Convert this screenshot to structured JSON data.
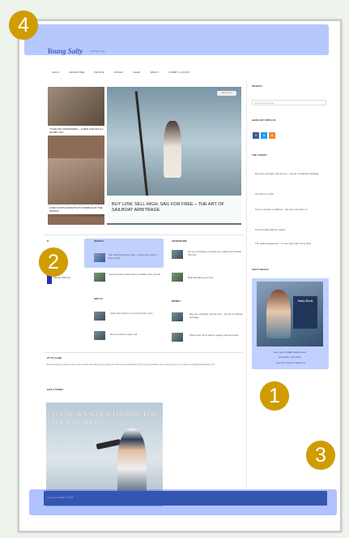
{
  "site": {
    "brand": "Young Salty",
    "tagline": "salt life & tips"
  },
  "nav": [
    "",
    "SAILS",
    "ADVENTURE",
    "PEOPLE",
    "MONEY",
    "GEAR",
    "ABOUT",
    "SUBMIT A STORY"
  ],
  "featured": {
    "left_top_caption": "'S SAILING FORMANDER – A NEW OVE WITH A HUMBY AST",
    "left_bottom_caption": "LIVEN COUPLE BUILDS AT IN MIDDLE OF THE WOODS",
    "main_caption": "BUY LOW, SELL HIGH, SAIL FOR FREE – THE ART OF SAILBOAT ARBITRAGE",
    "main_badge": "BEST OF YS"
  },
  "sections": {
    "people_label": "PEOPLE",
    "people_items": [
      "The call the world is your  - a new story with a funny twist",
      "Young couple builds boat in middle of the woods"
    ],
    "skills_label": "SKILLS",
    "skills_items": [
      "Clean the bottom of your boat like a pro",
      "How to anchor under sail"
    ],
    "adventure_label": "ADVENTURE",
    "adventure_items": [
      "So you're thinking of fixing your sailing trip? Read this first",
      "Boat life/Hitting you tips"
    ],
    "money_label": "MONEY",
    "money_items": [
      "Buy low, sell high, sail for free – the art of sailboat arbitrage",
      "Work snob job & debt to sailing and surrender"
    ],
    "left_col_label": "H",
    "left_col_text": "tutorial Offshore"
  },
  "sidebar": {
    "search_title": "SEARCH",
    "search_placeholder": "Enter your keywords...",
    "social_title": "HANG OUT WITH US",
    "social_icons": [
      "f",
      "t",
      "s"
    ],
    "latest_title": "THE LATEST",
    "latest_items": [
      "Buy low, sell high, sail for free – the art of sailboat arbitrage",
      "Sunshine on 100",
      "How to cement a sailboat – the love you lived on",
      "5 homemade gifts for sailors",
      "The sailing sweetener – a new story with funny twist"
    ],
    "deals_title": "SALTY DEALS",
    "deal_book_title": "Salty Book",
    "deal_caption_1": "Ever get a FREE Sailing book",
    "deal_caption_2": "subscribe, visit offers",
    "deal_caption_3": "- Join the Young & Salty List"
  },
  "lower": {
    "title_1": "IP US A LINE",
    "body": "We would that you and us more more shows! How about young sailor you think we should profile? Sent us your feedback, story sent and you to to writers at info@youngandsalty.com",
    "title_2": "GOT A STORY",
    "promo_line_1": "YOUNG & SALTY IS LOOKING FOR YOUR STORIES!",
    "promo_line_2": "WANT TO SHARE YOUR STORY? DROP US A LINE AT ABOUT@YOUNGANDSALTY.COM"
  },
  "footer": {
    "text": "Young and Salty © 2015"
  },
  "markers": [
    "1",
    "2",
    "3",
    "4"
  ],
  "colors": {
    "marker": "#d09c00",
    "highlight": "#5a87ff",
    "brand": "#4a5bbf",
    "footer": "#3556b0"
  }
}
